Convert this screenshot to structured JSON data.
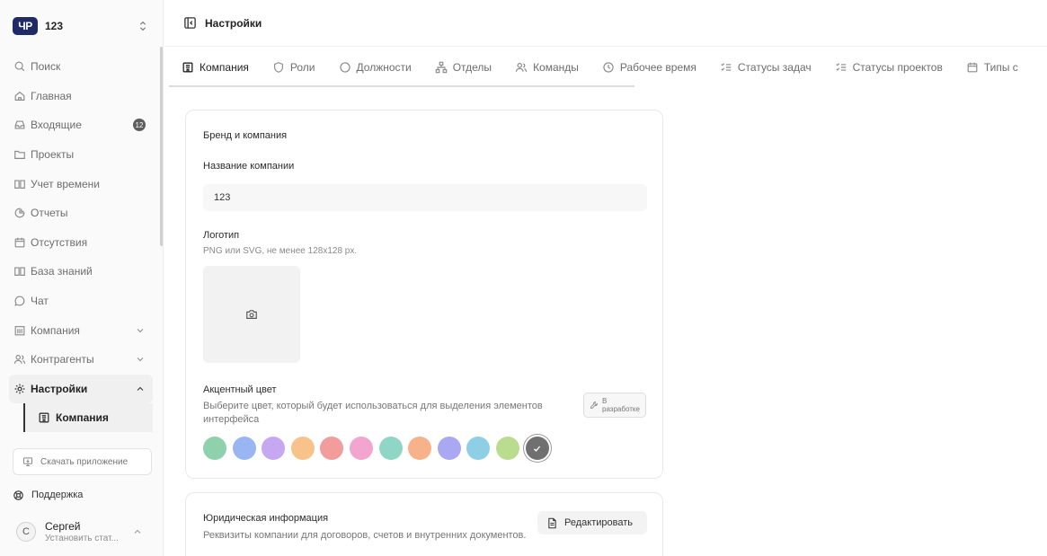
{
  "workspace": {
    "logo_text": "ЧР",
    "name": "123"
  },
  "sidebar": {
    "items": [
      {
        "label": "Поиск"
      },
      {
        "label": "Главная"
      },
      {
        "label": "Входящие",
        "badge": "12"
      },
      {
        "label": "Проекты"
      },
      {
        "label": "Учет времени"
      },
      {
        "label": "Отчеты"
      },
      {
        "label": "Отсутствия"
      },
      {
        "label": "База знаний"
      },
      {
        "label": "Чат"
      },
      {
        "label": "Компания"
      },
      {
        "label": "Контрагенты"
      },
      {
        "label": "Настройки"
      }
    ],
    "sub_item": "Компания",
    "download_label": "Скачать приложение",
    "support_label": "Поддержка",
    "user": {
      "initial": "С",
      "name": "Сергей",
      "status": "Установить стат..."
    }
  },
  "header": {
    "title": "Настройки"
  },
  "tabs": [
    {
      "label": "Компания"
    },
    {
      "label": "Роли"
    },
    {
      "label": "Должности"
    },
    {
      "label": "Отделы"
    },
    {
      "label": "Команды"
    },
    {
      "label": "Рабочее время"
    },
    {
      "label": "Статусы задач"
    },
    {
      "label": "Статусы проектов"
    },
    {
      "label": "Типы с"
    }
  ],
  "brand": {
    "section_title": "Бренд и компания",
    "company_name_label": "Название компании",
    "company_name_value": "123",
    "logo_title": "Логотип",
    "logo_hint": "PNG или SVG, не менее 128x128 px.",
    "accent_title": "Акцентный цвет",
    "accent_desc": "Выберите цвет, который будет использоваться для выделения элементов интерфейса",
    "dev_badge_top": "В",
    "dev_badge_bottom": "разработке",
    "swatch_colors": [
      "#8fd1ad",
      "#9ab6f2",
      "#c6a8f2",
      "#f7c38a",
      "#f29c9c",
      "#f2a6cf",
      "#8fd6c6",
      "#f7b28a",
      "#aaa8f2",
      "#8fcfe6",
      "#b9dc8f",
      "#707070"
    ]
  },
  "legal": {
    "title": "Юридическая информация",
    "desc": "Реквизиты компании для договоров, счетов и внутренних документов.",
    "edit_label": "Редактировать"
  }
}
